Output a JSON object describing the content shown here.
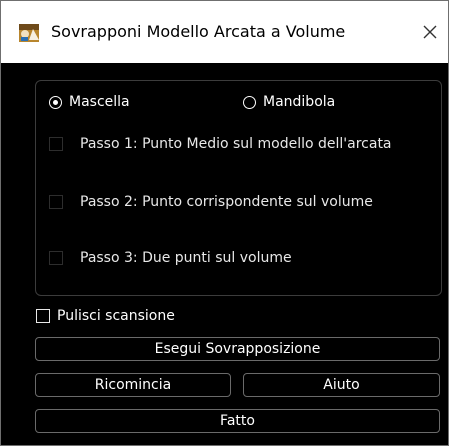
{
  "window": {
    "title": "Sovrapponi Modello Arcata a Volume",
    "icon": "app-logo-icon",
    "close_icon": "close-icon"
  },
  "arch_selection": {
    "options": [
      {
        "label": "Mascella",
        "selected": true
      },
      {
        "label": "Mandibola",
        "selected": false
      }
    ]
  },
  "steps": [
    {
      "label": "Passo 1: Punto Medio sul modello dell'arcata",
      "checked": false
    },
    {
      "label": "Passo 2: Punto corrispondente sul volume",
      "checked": false
    },
    {
      "label": "Passo 3: Due punti sul volume",
      "checked": false
    }
  ],
  "clear_scan": {
    "label": "Pulisci scansione",
    "checked": false
  },
  "buttons": {
    "execute": "Esegui Sovrapposizione",
    "restart": "Ricomincia",
    "help": "Aiuto",
    "done": "Fatto"
  },
  "colors": {
    "background": "#000000",
    "titlebar": "#ffffff",
    "text": "#ffffff",
    "border": "#6a6a6a"
  }
}
